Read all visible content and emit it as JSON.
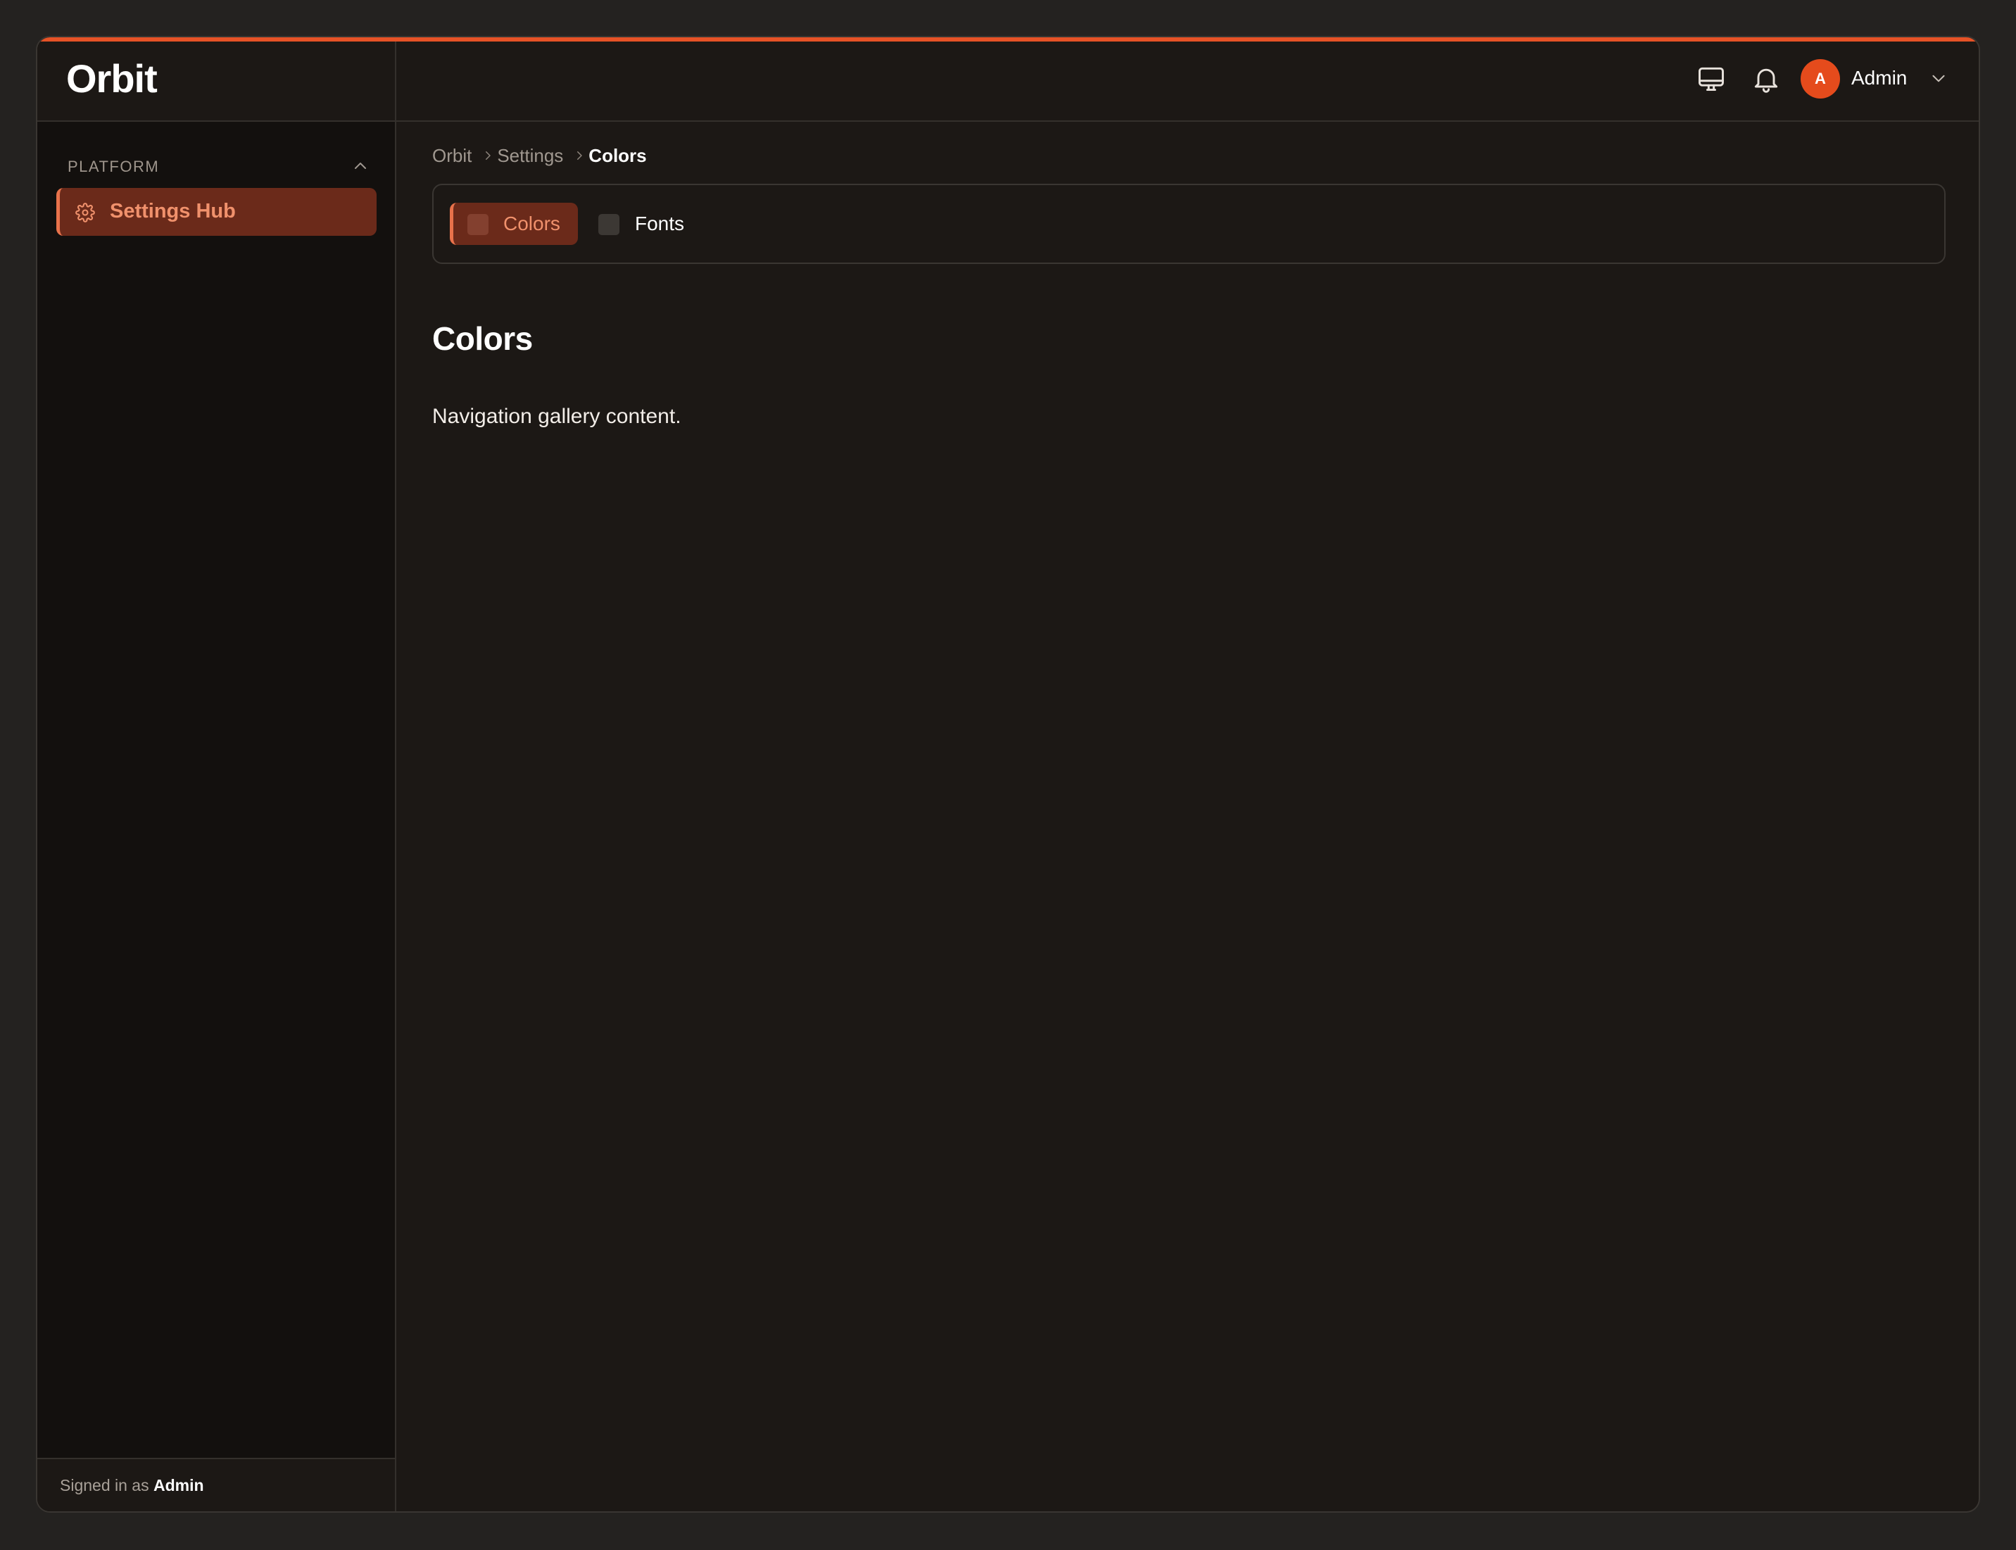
{
  "app": {
    "brand": "Orbit",
    "accent_color": "#e65226"
  },
  "sidebar": {
    "section_label": "PLATFORM",
    "section_toggle_icon": "chevron-up-icon",
    "items": [
      {
        "label": "Settings Hub",
        "icon": "gear-icon",
        "active": true
      }
    ],
    "footer": {
      "prefix": "Signed in as",
      "user": "Admin"
    }
  },
  "header": {
    "icons": [
      "monitor-icon",
      "bell-icon"
    ],
    "avatar_initial": "A",
    "user_name": "Admin",
    "user_menu_icon": "chevron-down-icon"
  },
  "breadcrumb": {
    "items": [
      "Orbit",
      "Settings",
      "Colors"
    ]
  },
  "tabs": [
    {
      "label": "Colors",
      "active": true
    },
    {
      "label": "Fonts",
      "active": false
    }
  ],
  "main": {
    "title": "Colors",
    "body": "Navigation gallery content."
  }
}
